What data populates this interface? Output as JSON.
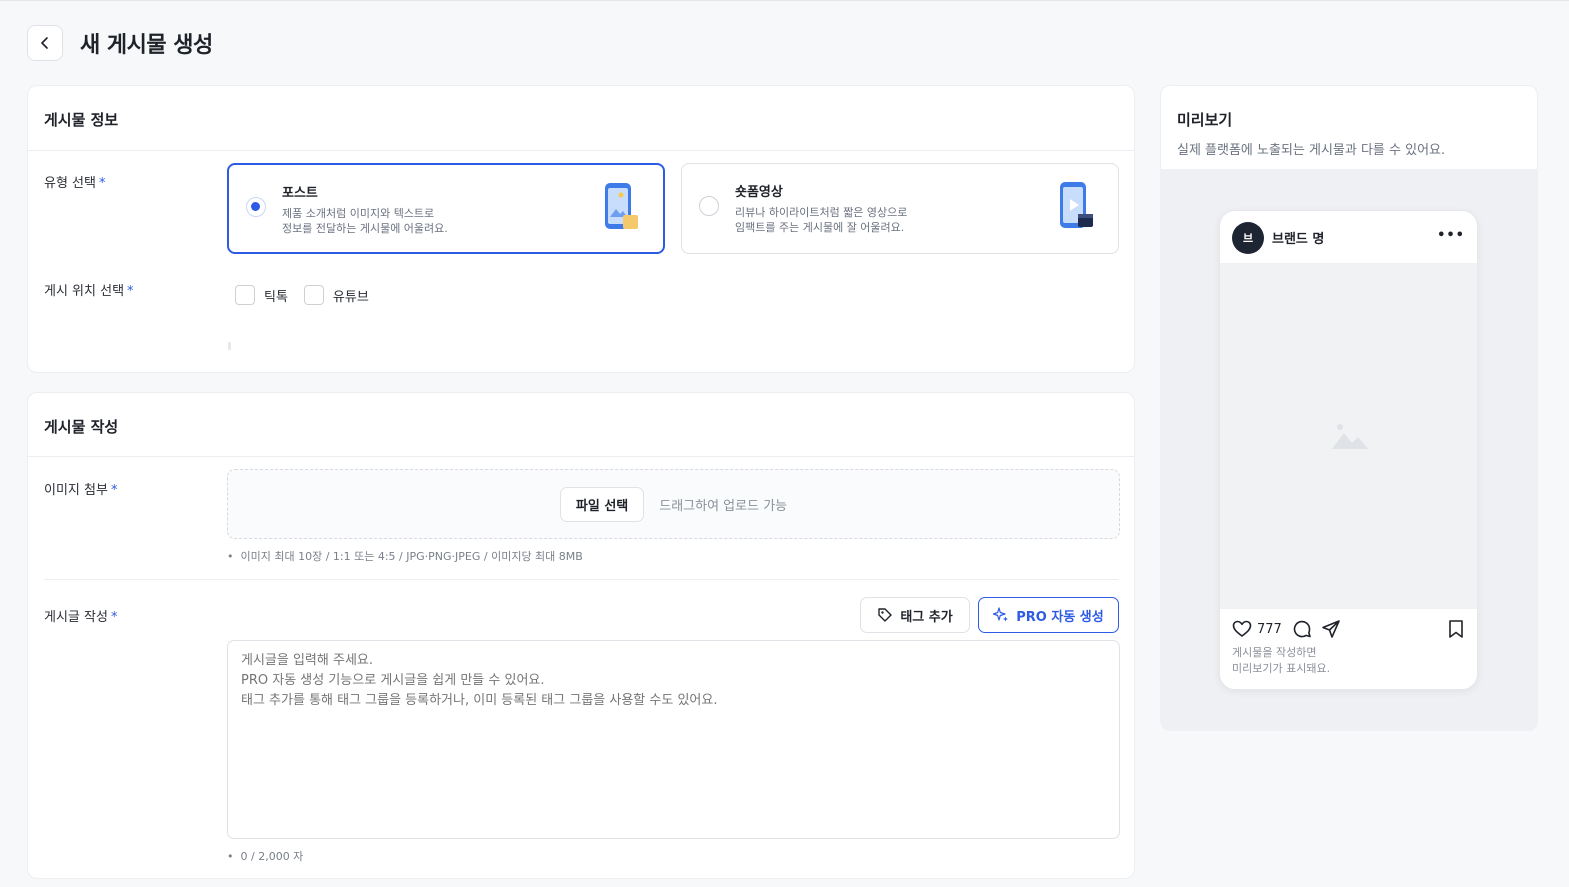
{
  "header": {
    "title": "새 게시물 생성"
  },
  "info": {
    "title": "게시물 정보",
    "type_label": "유형 선택",
    "types": [
      {
        "title": "포스트",
        "desc1": "제품 소개처럼 이미지와 텍스트로",
        "desc2": "정보를 전달하는 게시물에 어울려요.",
        "selected": true
      },
      {
        "title": "숏폼영상",
        "desc1": "리뷰나 하이라이트처럼 짧은 영상으로",
        "desc2": "임팩트를 주는 게시물에 잘 어울려요.",
        "selected": false
      }
    ],
    "location_label": "게시 위치 선택",
    "locations": [
      "틱톡",
      "유튜브"
    ]
  },
  "compose": {
    "title": "게시물 작성",
    "image_label": "이미지 첨부",
    "file_button": "파일 선택",
    "drag_hint": "드래그하여 업로드 가능",
    "image_note": "이미지 최대 10장 / 1:1 또는 4:5 / JPG·PNG·JPEG / 이미지당 최대 8MB",
    "text_label": "게시글 작성",
    "tag_button": "태그 추가",
    "pro_button": "PRO 자동 생성",
    "placeholder": "게시글을 입력해 주세요.\nPRO 자동 생성 기능으로 게시글을 쉽게 만들 수 있어요.\n태그 추가를 통해 태그 그룹을 등록하거나, 이미 등록된 태그 그룹을 사용할 수도 있어요.",
    "char_count": "0 / 2,000 자"
  },
  "preview": {
    "title": "미리보기",
    "subtitle": "실제 플랫폼에 노출되는 게시물과 다를 수 있어요.",
    "avatar_text": "브",
    "brand": "브랜드 명",
    "more": "•••",
    "likes": "777",
    "placeholder_line1": "게시물을 작성하면",
    "placeholder_line2": "미리보기가 표시돼요."
  },
  "colors": {
    "accent": "#2d5be3",
    "required": "#2d5be3",
    "avatar_bg": "#1d2533"
  }
}
